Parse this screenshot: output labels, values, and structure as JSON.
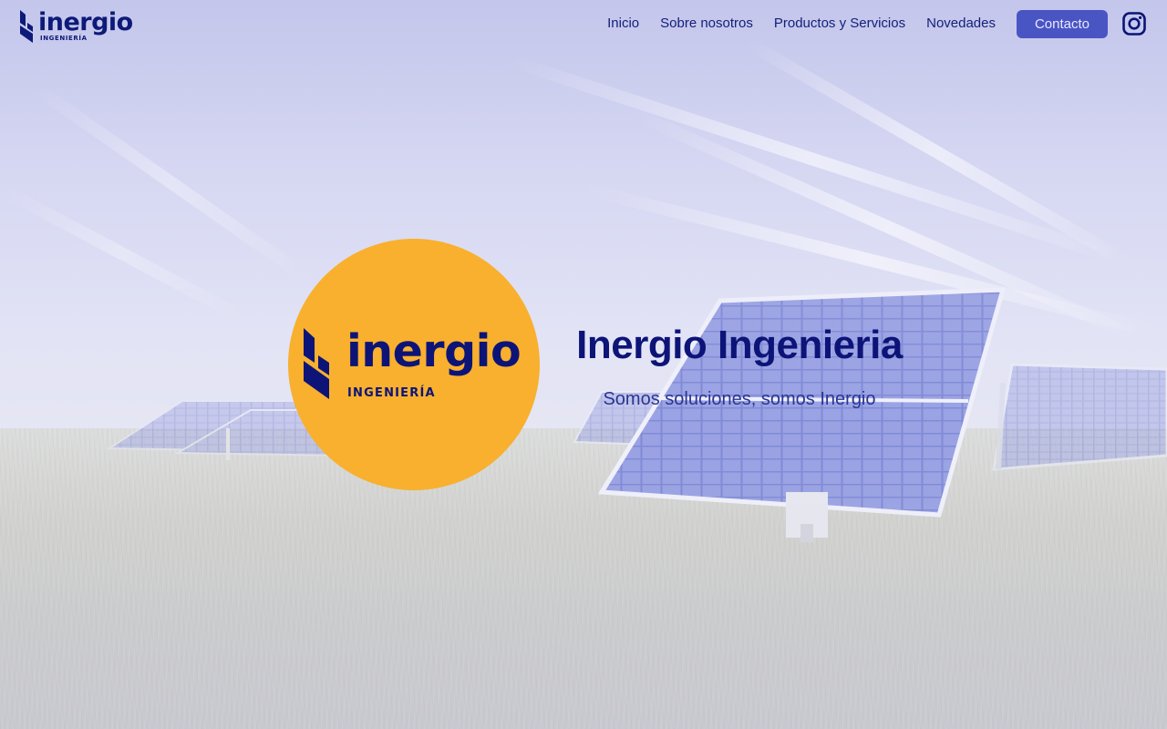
{
  "brand": {
    "name": "inergio",
    "tagline": "INGENIERÍA"
  },
  "nav": {
    "items": [
      {
        "label": "Inicio"
      },
      {
        "label": "Sobre nosotros"
      },
      {
        "label": "Productos y Servicios"
      },
      {
        "label": "Novedades"
      }
    ],
    "contact_label": "Contacto",
    "social_icon": "instagram-icon"
  },
  "hero": {
    "logo_name": "inergio",
    "logo_tagline": "INGENIERÍA",
    "title": "Inergio Ingenieria",
    "subtitle": "Somos soluciones, somos Inergio"
  },
  "colors": {
    "brand_navy": "#0d1478",
    "accent_yellow": "#f8b02e",
    "button_blue": "#4a55c4"
  }
}
